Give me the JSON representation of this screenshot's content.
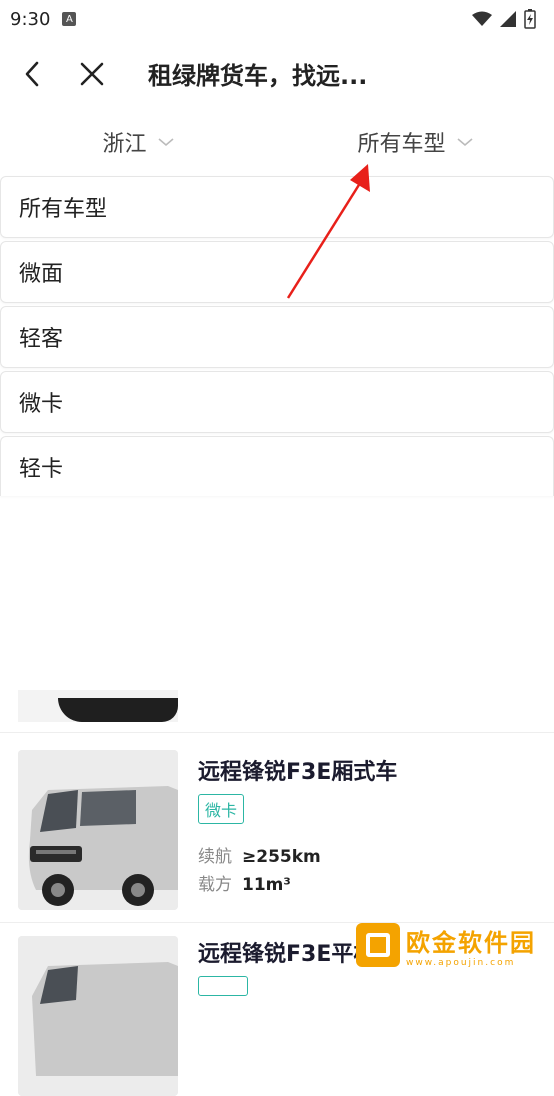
{
  "status_bar": {
    "time": "9:30",
    "app_icon_letter": "A"
  },
  "header": {
    "title": "租绿牌货车，找远..."
  },
  "filters": {
    "region": "浙江",
    "vehicle_type": "所有车型"
  },
  "dropdown": {
    "options": [
      "所有车型",
      "微面",
      "轻客",
      "微卡",
      "轻卡"
    ]
  },
  "cars": [
    {
      "name": "远程锋锐F3E厢式车",
      "tag": "微卡",
      "range_label": "续航",
      "range_value": "≥255km",
      "volume_label": "载方",
      "volume_value": "11m³"
    },
    {
      "name": "远程锋锐F3E平板车"
    }
  ],
  "watermark": {
    "title": "欧金软件园",
    "url": "www.apoujin.com"
  },
  "colors": {
    "accent_teal": "#2cb6a4",
    "arrow_red": "#e8201a",
    "watermark_orange": "#f4a300"
  }
}
